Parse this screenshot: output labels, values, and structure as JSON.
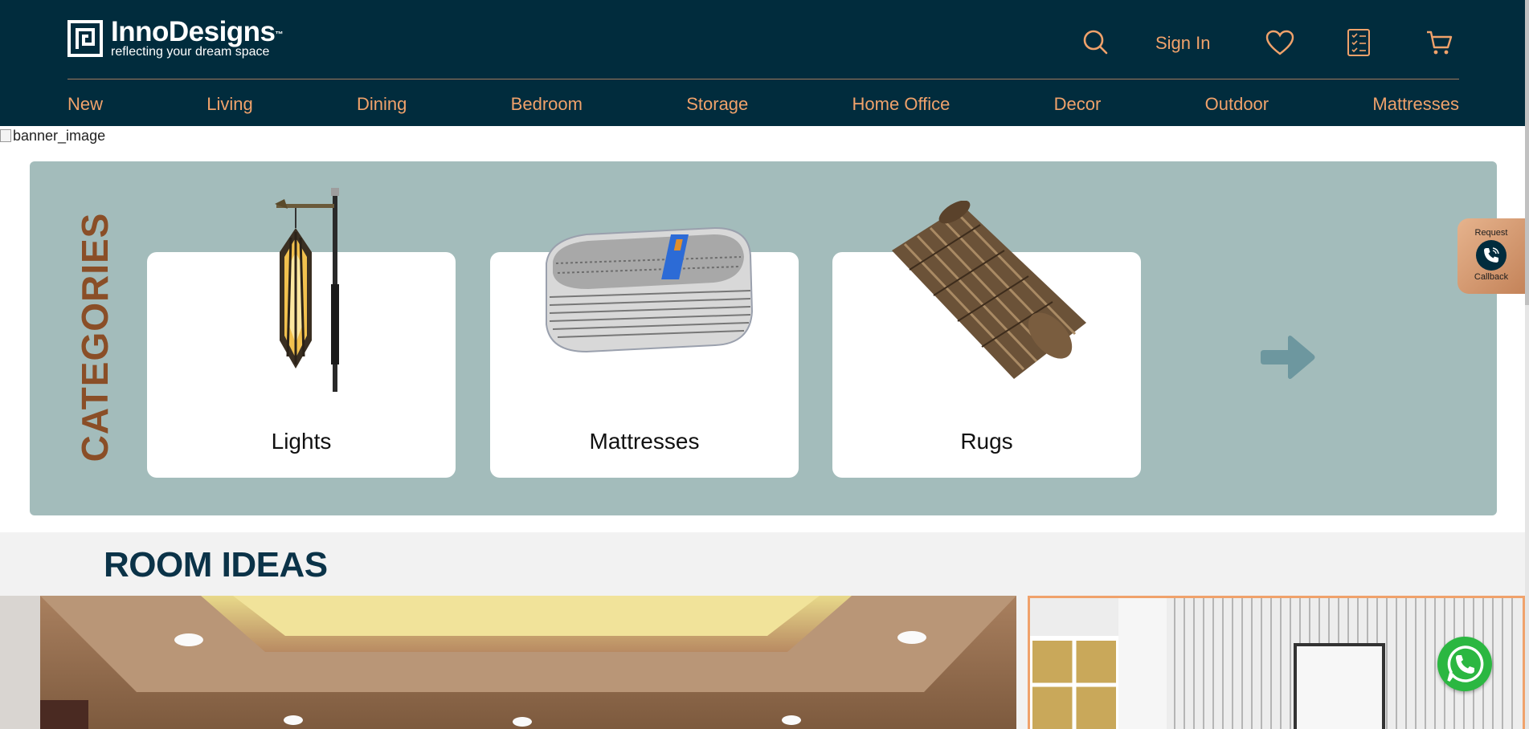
{
  "brand": {
    "name": "InnoDesigns",
    "trademark": "™",
    "tagline": "reflecting your dream space",
    "bg_color": "#012c3d",
    "accent_color": "#f0a26b"
  },
  "header_actions": {
    "search_icon": "search-icon",
    "signin_label": "Sign In",
    "wishlist_icon": "heart-icon",
    "checklist_icon": "checklist-icon",
    "cart_icon": "cart-icon"
  },
  "nav": {
    "items": [
      "New",
      "Living",
      "Dining",
      "Bedroom",
      "Storage",
      "Home Office",
      "Decor",
      "Outdoor",
      "Mattresses"
    ]
  },
  "banner": {
    "alt_text": "banner_image"
  },
  "categories": {
    "title": "CATEGORIES",
    "bg_color": "#a3bcbb",
    "title_color": "#8a4e27",
    "items": [
      {
        "label": "Lights",
        "image": "lantern-lamp"
      },
      {
        "label": "Mattresses",
        "image": "mattress"
      },
      {
        "label": "Rugs",
        "image": "rolled-rug"
      }
    ],
    "next_icon": "arrow-right-icon"
  },
  "callback": {
    "line1": "Request",
    "line2": "Callback",
    "icon": "phone-icon"
  },
  "room_ideas": {
    "title": "ROOM IDEAS"
  },
  "whatsapp": {
    "icon": "whatsapp-icon"
  }
}
